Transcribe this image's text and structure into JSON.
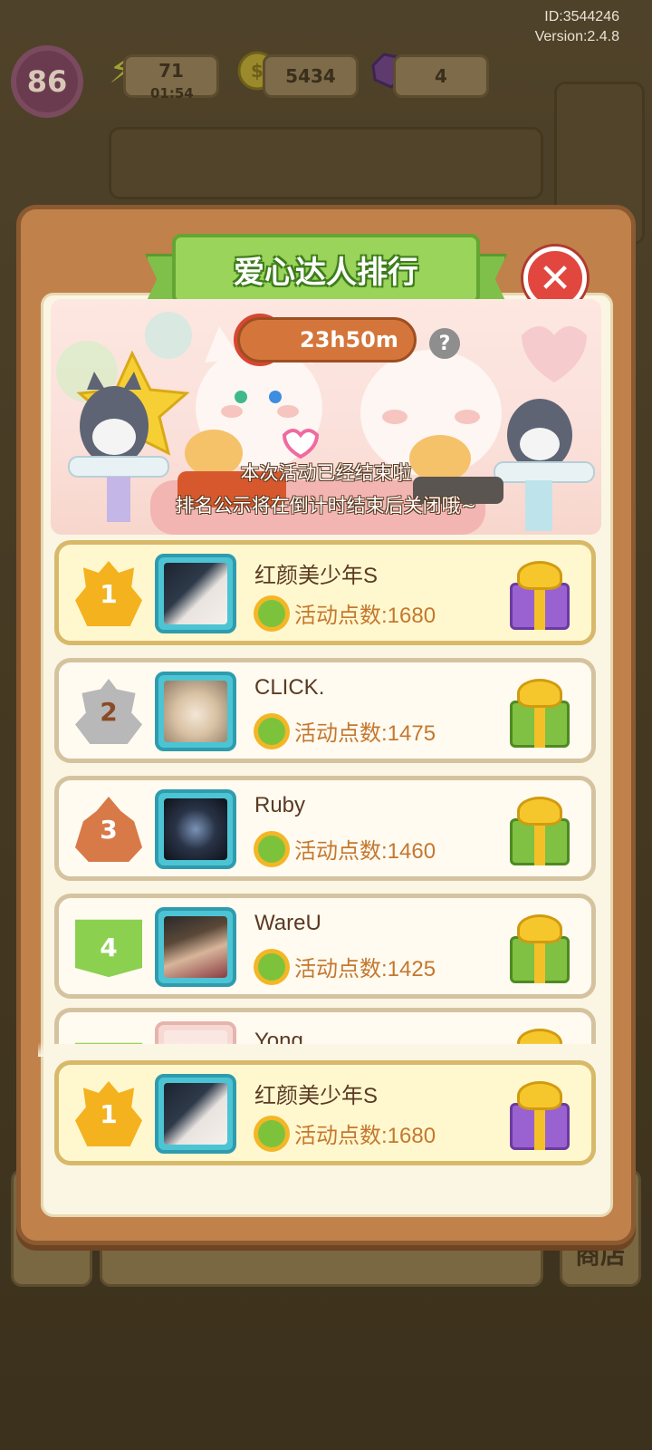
{
  "meta": {
    "id_text": "ID:3544246",
    "version_text": "Version:2.4.8"
  },
  "hud": {
    "level": "86",
    "energy": "71",
    "energy_timer": "01:54",
    "coins": "5434",
    "gems": "4",
    "energy_icon": "lightning-icon",
    "coin_icon": "coin-icon",
    "gem_icon": "gem-icon"
  },
  "background": {
    "shop_label": "商店"
  },
  "dialog": {
    "title": "爱心达人排行",
    "close_icon": "close-icon",
    "countdown": "23h50m",
    "help_label": "?",
    "notice_line1": "本次活动已经结束啦",
    "notice_line2": "排名公示将在倒计时结束后关闭哦~"
  },
  "ranking": {
    "score_prefix": "活动点数:",
    "rows": [
      {
        "rank": "1",
        "name": "红颜美少年S",
        "score": "活动点数:1680",
        "badge": "gold",
        "gift": "purple"
      },
      {
        "rank": "2",
        "name": "CLICK.",
        "score": "活动点数:1475",
        "badge": "silver",
        "gift": "green"
      },
      {
        "rank": "3",
        "name": "Ruby",
        "score": "活动点数:1460",
        "badge": "bronze",
        "gift": "green"
      },
      {
        "rank": "4",
        "name": "WareU",
        "score": "活动点数:1425",
        "badge": "green",
        "gift": "green"
      },
      {
        "rank": "",
        "name": "Yong",
        "score": "",
        "badge": "green",
        "gift": "green"
      }
    ],
    "self": {
      "rank": "1",
      "name": "红颜美少年S",
      "score": "活动点数:1680",
      "badge": "gold",
      "gift": "purple"
    }
  },
  "colors": {
    "panel_brown": "#c1814b",
    "ribbon_green": "#9ad45a",
    "close_red": "#e2473f",
    "score_orange": "#c4782f",
    "gold_row": "#fff8cf"
  }
}
